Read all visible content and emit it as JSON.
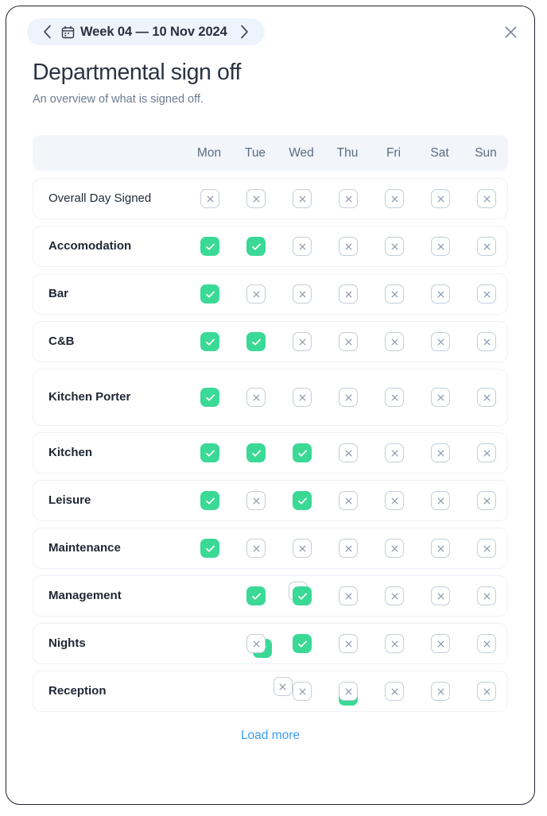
{
  "header": {
    "prev_label": "‹",
    "next_label": "›",
    "calendar_icon": "calendar-icon",
    "week_prefix": "Week ",
    "week_range": "04 — 10 Nov 2024",
    "week_full": "Week 04 — 10 Nov 2024",
    "close_label": "×"
  },
  "titles": {
    "title": "Departmental sign off",
    "subtitle": "An overview of what is signed off."
  },
  "table": {
    "columns": [
      "Mon",
      "Tue",
      "Wed",
      "Thu",
      "Fri",
      "Sat",
      "Sun"
    ],
    "column_centers": [
      222,
      280,
      338,
      396,
      454,
      512,
      570
    ],
    "rows": [
      {
        "label": "Overall Day Signed",
        "emphasis": "light",
        "values": [
          false,
          false,
          false,
          false,
          false,
          false,
          false
        ]
      },
      {
        "label": "Accomodation",
        "emphasis": "bold",
        "values": [
          true,
          true,
          false,
          false,
          false,
          false,
          false
        ]
      },
      {
        "label": "Bar",
        "emphasis": "bold",
        "values": [
          true,
          false,
          false,
          false,
          false,
          false,
          false
        ]
      },
      {
        "label": "C&B",
        "emphasis": "bold",
        "values": [
          true,
          true,
          false,
          false,
          false,
          false,
          false
        ]
      },
      {
        "label": "Kitchen Porter",
        "emphasis": "bold",
        "values": [
          true,
          false,
          false,
          false,
          false,
          false,
          false
        ]
      },
      {
        "label": "Kitchen",
        "emphasis": "bold",
        "values": [
          true,
          true,
          true,
          false,
          false,
          false,
          false
        ]
      },
      {
        "label": "Leisure",
        "emphasis": "bold",
        "values": [
          true,
          false,
          true,
          false,
          false,
          false,
          false
        ]
      },
      {
        "label": "Maintenance",
        "emphasis": "bold",
        "values": [
          true,
          false,
          false,
          false,
          false,
          false,
          false
        ]
      },
      {
        "label": "Management",
        "emphasis": "bold",
        "values": [
          false,
          true,
          true,
          false,
          false,
          false,
          false
        ]
      },
      {
        "label": "Nights",
        "emphasis": "bold",
        "values": [
          true,
          false,
          true,
          false,
          false,
          false,
          false
        ]
      },
      {
        "label": "Reception",
        "emphasis": "bold",
        "values": [
          false,
          true,
          false,
          false,
          false,
          false,
          false
        ]
      }
    ]
  },
  "footer": {
    "load_more": "Load more"
  },
  "colors": {
    "checked_green": "#3ad995",
    "unchecked_border": "#c3cdda",
    "link_blue": "#3b9ef5",
    "pill_bg": "#eef4fb",
    "header_row_bg": "#f2f5fa"
  }
}
